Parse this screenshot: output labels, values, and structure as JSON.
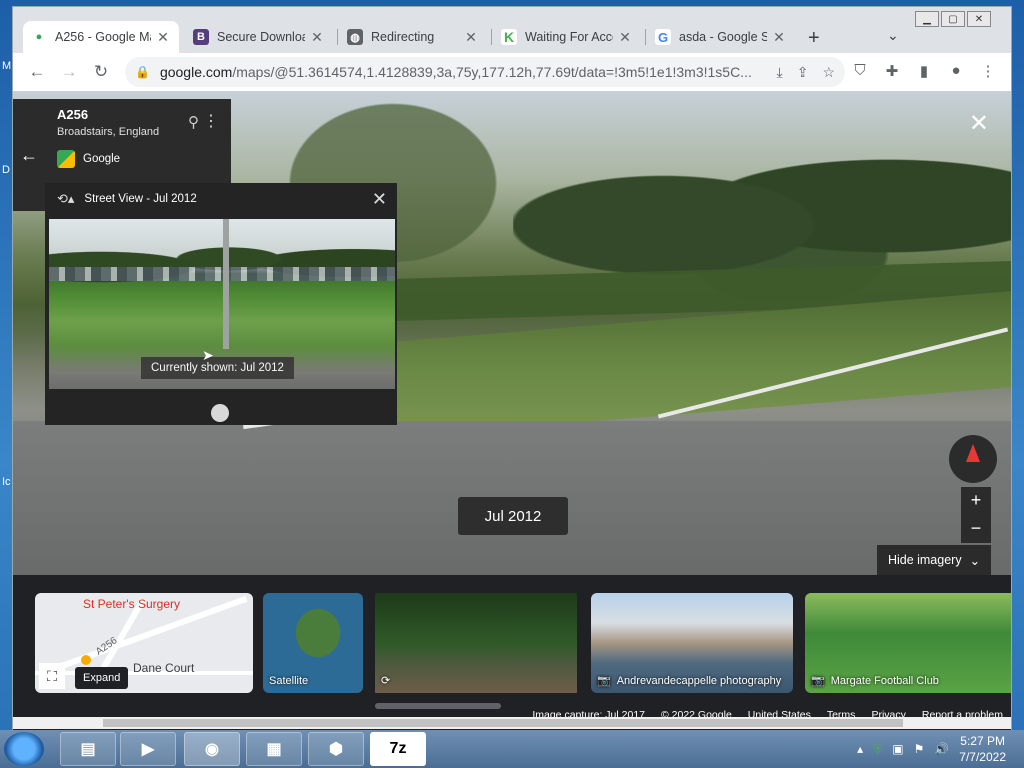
{
  "desktop": {
    "left_chars": [
      "M",
      "D",
      "Ic"
    ]
  },
  "tabs": [
    {
      "title": "A256 - Google Maps",
      "favicon": "maps-pin-icon",
      "active": true
    },
    {
      "title": "Secure Download",
      "favicon": "b-icon"
    },
    {
      "title": "Redirecting",
      "favicon": "globe-icon"
    },
    {
      "title": "Waiting For Access",
      "favicon": "k-icon"
    },
    {
      "title": "asda - Google Search",
      "favicon": "google-g-icon"
    }
  ],
  "toolbar": {
    "url_domain": "google.com",
    "url_rest": "/maps/@51.3614574,1.4128839,3a,75y,177.12h,77.69t/data=!3m5!1e1!3m3!1s5C..."
  },
  "place": {
    "name": "A256",
    "subtitle": "Broadstairs, England",
    "source": "Google"
  },
  "time_travel": {
    "header": "Street View - Jul 2012",
    "currently_shown": "Currently shown: Jul 2012"
  },
  "viewer": {
    "date_chip": "Jul 2012",
    "hide_imagery": "Hide imagery"
  },
  "strip": {
    "map": {
      "poi": "St Peter's Surgery",
      "road": "A256",
      "poi2": "Dane Court",
      "expand_tip": "Expand"
    },
    "satellite_label": "Satellite",
    "photo1_label": "Andrevandecappelle photography",
    "photo2_label": "Margate Football Club"
  },
  "footer": [
    "Image capture: Jul 2017",
    "© 2022 Google",
    "United States",
    "Terms",
    "Privacy",
    "Report a problem"
  ],
  "taskbar": {
    "time": "5:27 PM",
    "date": "7/7/2022"
  }
}
